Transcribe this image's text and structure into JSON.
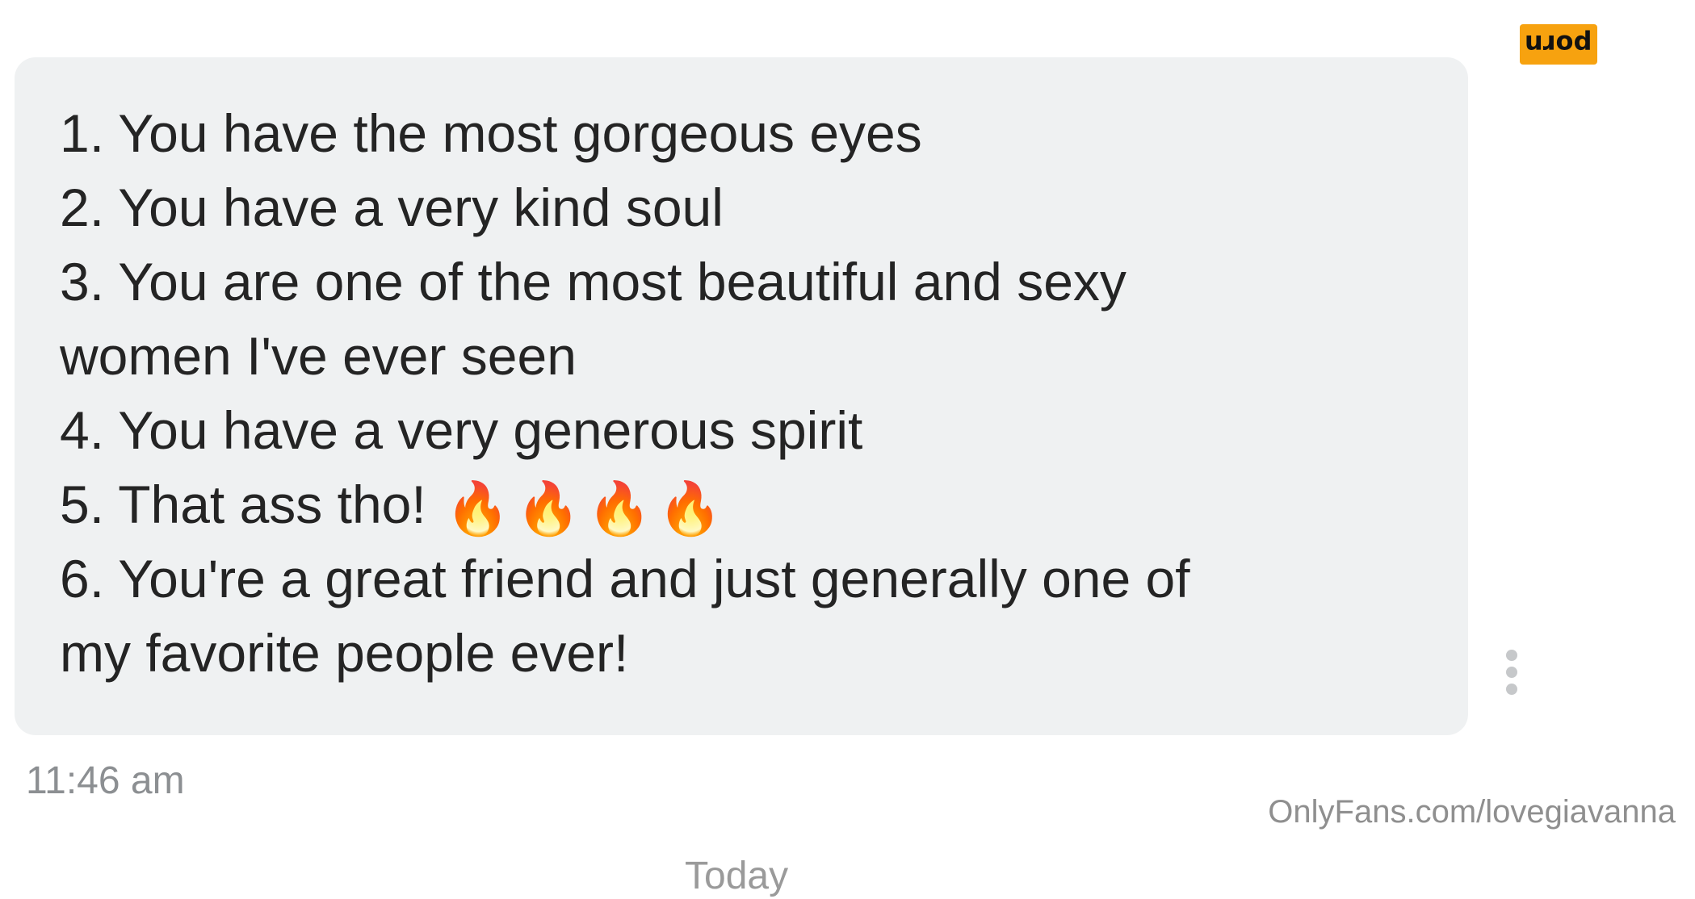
{
  "message": {
    "lines": [
      "1. You have the most gorgeous eyes",
      "2. You have a very kind soul",
      "3. You are one of the most beautiful and sexy",
      "women I've ever seen",
      "4. You have a very generous spirit",
      "5. That ass tho!",
      "6. You're a great friend and just generally one of",
      "my favorite people ever!"
    ],
    "emoji": [
      "🔥",
      "🔥",
      "🔥",
      "🔥"
    ],
    "timestamp": "11:46 am"
  },
  "day_divider": "Today",
  "watermark": "OnlyFans.com/lovegiavanna",
  "badge": {
    "text": "porn",
    "color": "#f7a20f"
  },
  "colors": {
    "bubble_background": "#eff1f2",
    "message_text": "#242424",
    "timestamp_text": "#8c8f92"
  },
  "icons": {
    "more_options": "more-vertical-icon"
  }
}
